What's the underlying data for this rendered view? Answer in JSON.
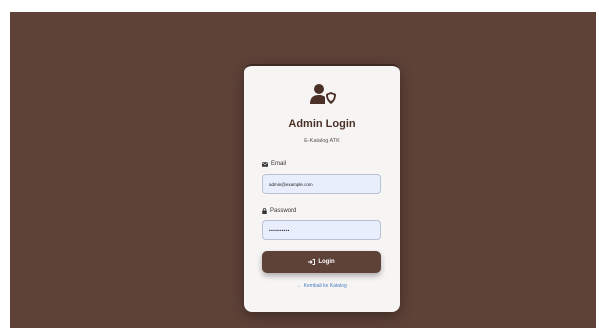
{
  "login": {
    "title": "Admin Login",
    "subtitle": "E-Katalog ATK",
    "email_label": "Email",
    "email_value": "admin@example.com",
    "password_label": "Password",
    "password_value": "••••••••••",
    "login_button": "Login",
    "back_link": "← Kembali ke Katalog"
  },
  "icons": {
    "header": "user-shield-icon",
    "email": "envelope-icon",
    "password": "lock-icon",
    "login": "sign-in-icon"
  },
  "colors": {
    "background": "#5e4238",
    "card": "#f7f5f4",
    "primary": "#5e4238",
    "title": "#4b3028",
    "input_bg": "#e9eefc",
    "link": "#4a7ec4"
  }
}
